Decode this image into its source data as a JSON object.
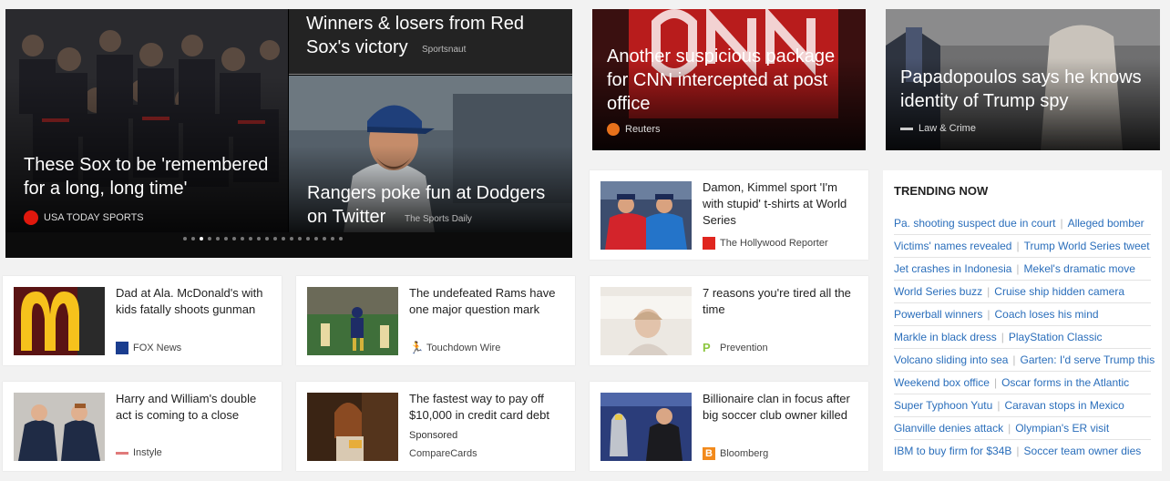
{
  "carousel": {
    "main": {
      "title": "These Sox to be 'remembered for a long, long time'",
      "source": "USA TODAY SPORTS"
    },
    "top_right": {
      "title": "Winners & losers from Red Sox's victory",
      "source": "Sportsnaut"
    },
    "bottom_right": {
      "title": "Rangers poke fun at Dodgers on Twitter",
      "source": "The Sports Daily"
    },
    "dots_count": 20,
    "active_dot": 2
  },
  "hero_cnn": {
    "title": "Another suspicious package for CNN intercepted at post office",
    "source": "Reuters"
  },
  "hero_papa": {
    "title": "Papadopoulos says he knows identity of Trump spy",
    "source": "Law & Crime"
  },
  "cards": {
    "damon": {
      "title": "Damon, Kimmel sport 'I'm with stupid' t-shirts at World Series",
      "source": "The Hollywood Reporter"
    },
    "dad": {
      "title": "Dad at Ala. McDonald's with kids fatally shoots gunman",
      "source": "FOX News"
    },
    "rams": {
      "title": "The undefeated Rams have one major question mark",
      "source": "Touchdown Wire"
    },
    "tired": {
      "title": "7 reasons you're tired all the time",
      "source": "Prevention"
    },
    "harry": {
      "title": "Harry and William's double act is coming to a close",
      "source": "Instyle"
    },
    "pay": {
      "title": "The fastest way to pay off $10,000 in credit card debt",
      "sponsored": "Sponsored",
      "source": "CompareCards"
    },
    "billionaire": {
      "title": "Billionaire clan in focus after big soccer club owner killed",
      "source": "Bloomberg"
    }
  },
  "trending": {
    "title": "TRENDING NOW",
    "rows": [
      [
        "Pa. shooting suspect due in court",
        "Alleged bomber"
      ],
      [
        "Victims' names revealed",
        "Trump World Series tweet"
      ],
      [
        "Jet crashes in Indonesia",
        "Mekel's dramatic move"
      ],
      [
        "World Series buzz",
        "Cruise ship hidden camera"
      ],
      [
        "Powerball winners",
        "Coach loses his mind"
      ],
      [
        "Markle in black dress",
        "PlayStation Classic"
      ],
      [
        "Volcano sliding into sea",
        "Garten: I'd serve Trump this"
      ],
      [
        "Weekend box office",
        "Oscar forms in the Atlantic"
      ],
      [
        "Super Typhoon Yutu",
        "Caravan stops in Mexico"
      ],
      [
        "Glanville denies attack",
        "Olympian's ER visit"
      ],
      [
        "IBM to buy firm for $34B",
        "Soccer team owner dies"
      ]
    ]
  }
}
